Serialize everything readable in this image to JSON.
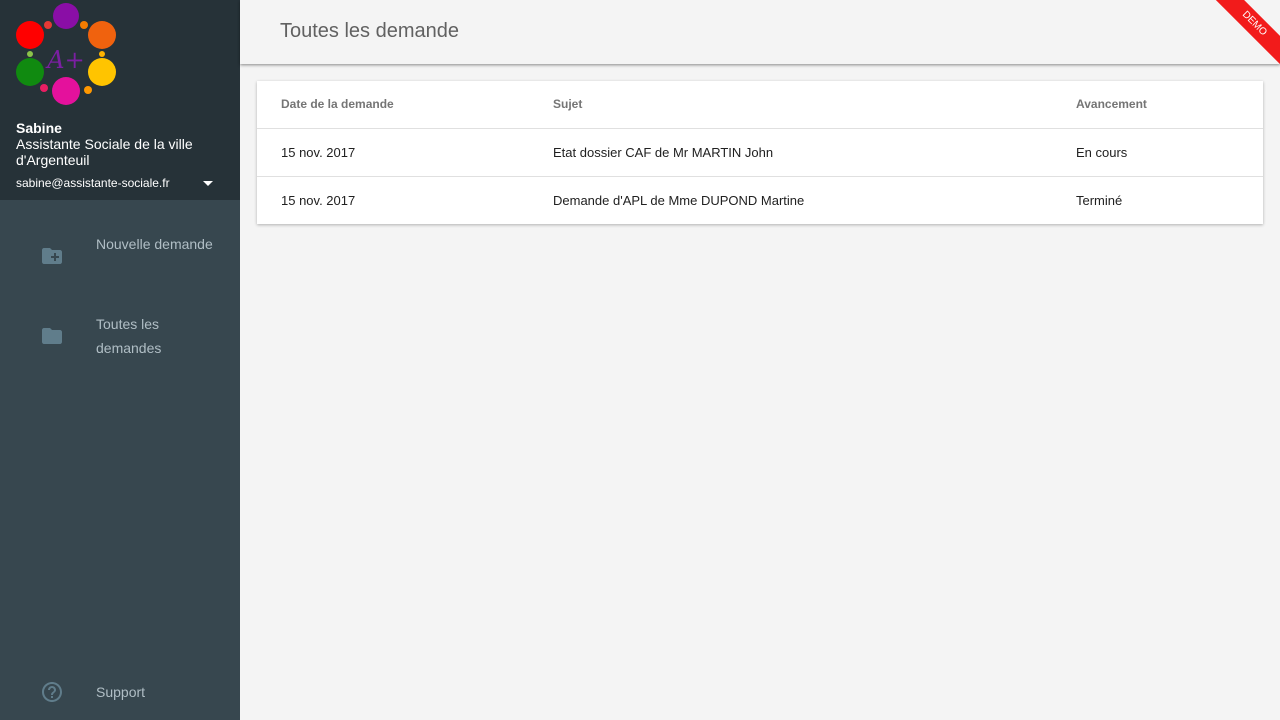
{
  "sidebar": {
    "user_name": "Sabine",
    "user_role": "Assistante Sociale de la ville d'Argenteuil",
    "user_email": "sabine@assistante-sociale.fr",
    "items": [
      {
        "label": "Nouvelle demande",
        "icon": "folder-add-icon"
      },
      {
        "label": "Toutes les demandes",
        "icon": "folder-icon"
      }
    ],
    "support_label": "Support",
    "support_icon": "help-circle-icon"
  },
  "header": {
    "title": "Toutes les demande",
    "ribbon": "DEMO"
  },
  "table": {
    "columns": [
      "Date de la demande",
      "Sujet",
      "Avancement"
    ],
    "rows": [
      [
        "15 nov. 2017",
        "Etat dossier CAF de Mr MARTIN John",
        "En cours"
      ],
      [
        "15 nov. 2017",
        "Demande d'APL de Mme DUPOND Martine",
        "Terminé"
      ]
    ]
  },
  "colors": {
    "sidebar_bg": "#37474f",
    "sidebar_header_bg": "#263238",
    "ribbon": "#f21b1b"
  }
}
